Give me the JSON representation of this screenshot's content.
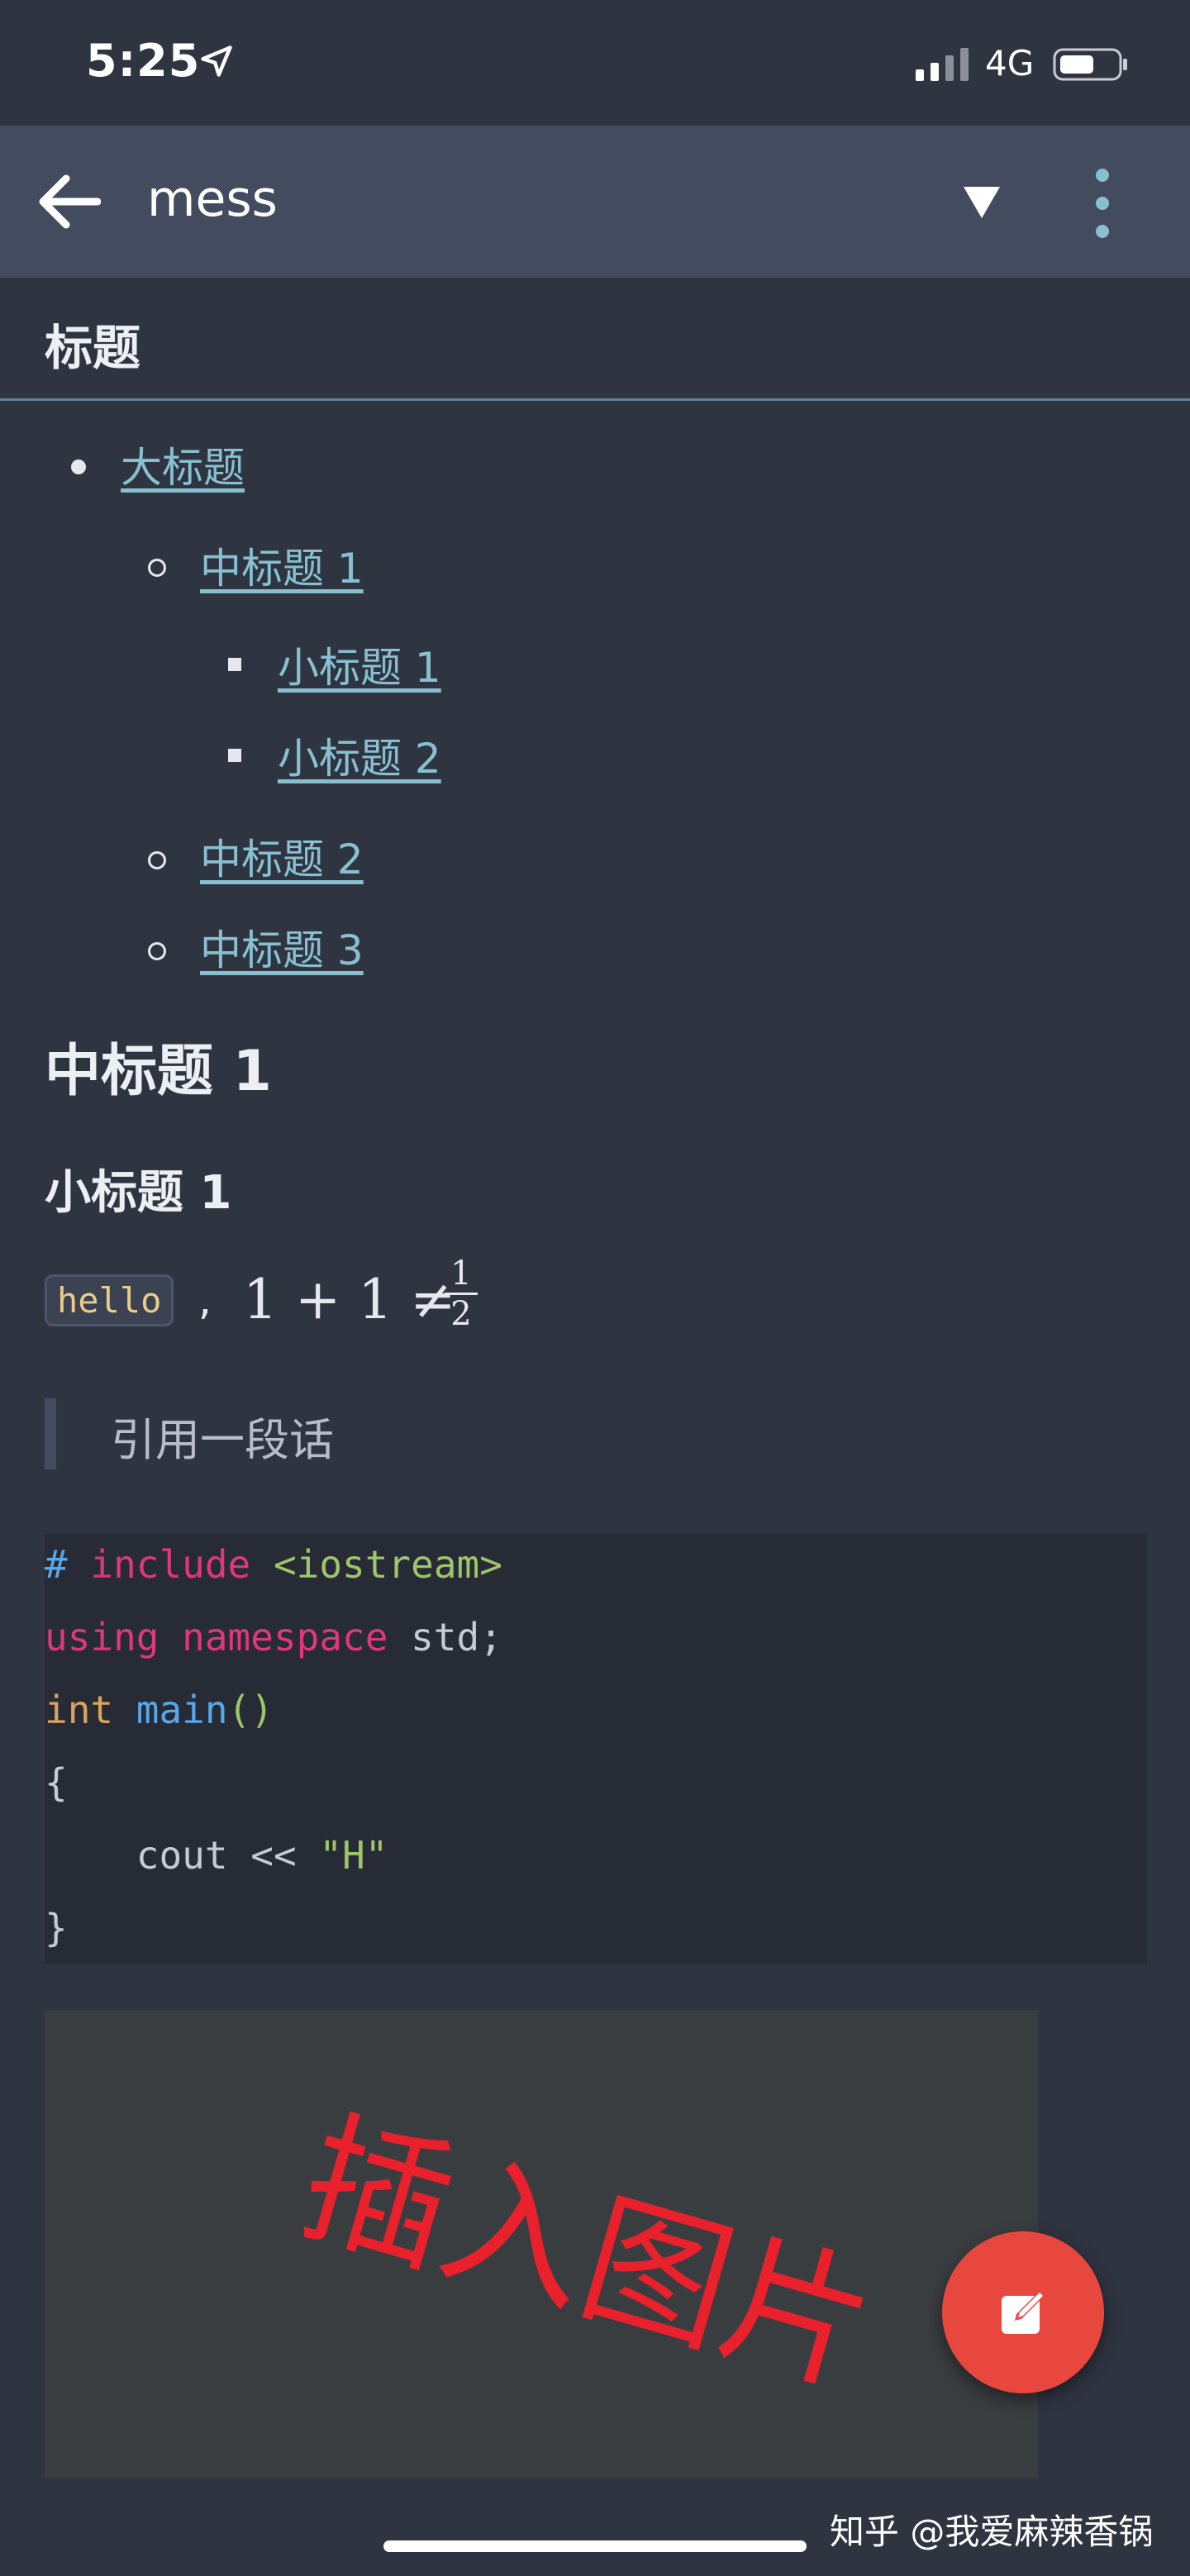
{
  "status_bar": {
    "time": "5:25",
    "network": "4G"
  },
  "app_bar": {
    "title": "mess"
  },
  "section": {
    "title": "标题"
  },
  "toc": {
    "items": [
      {
        "label": "大标题",
        "level": 1
      },
      {
        "label": "中标题 1",
        "level": 2
      },
      {
        "label": "小标题 1",
        "level": 3
      },
      {
        "label": "小标题 2",
        "level": 3
      },
      {
        "label": "中标题 2",
        "level": 2
      },
      {
        "label": "中标题 3",
        "level": 2
      }
    ]
  },
  "content": {
    "h2": "中标题 1",
    "h3": "小标题 1",
    "inline_code": "hello",
    "comma": ",",
    "math_expression": "1 + 1 ≠",
    "math_fraction": {
      "numerator": "1",
      "denominator": "2"
    },
    "blockquote": "引用一段话",
    "code_lines": [
      [
        {
          "text": "# ",
          "color": "#5aa6e8"
        },
        {
          "text": "include ",
          "color": "#e0367a"
        },
        {
          "text": "<iostream>",
          "color": "#9dc56a"
        }
      ],
      [
        {
          "text": "using namespace ",
          "color": "#e0367a"
        },
        {
          "text": "std;",
          "color": "#c6cad3"
        }
      ],
      [
        {
          "text": "int ",
          "color": "#d8a45e"
        },
        {
          "text": "main",
          "color": "#5aa6e8"
        },
        {
          "text": "()",
          "color": "#9dc56a"
        }
      ],
      [
        {
          "text": "{",
          "color": "#c6cad3"
        }
      ],
      [
        {
          "text": "    cout << ",
          "color": "#c6cad3"
        },
        {
          "text": "\"H\"",
          "color": "#9dc56a"
        }
      ],
      [
        {
          "text": "}",
          "color": "#c6cad3"
        }
      ]
    ],
    "image_text": "插入图片"
  },
  "watermark": "知乎 @我爱麻辣香锅",
  "colors": {
    "background": "#2f3441",
    "app_bar": "#434c5e",
    "link": "#88c0d0",
    "fab": "#e8473d",
    "image_text": "#e8212c"
  }
}
